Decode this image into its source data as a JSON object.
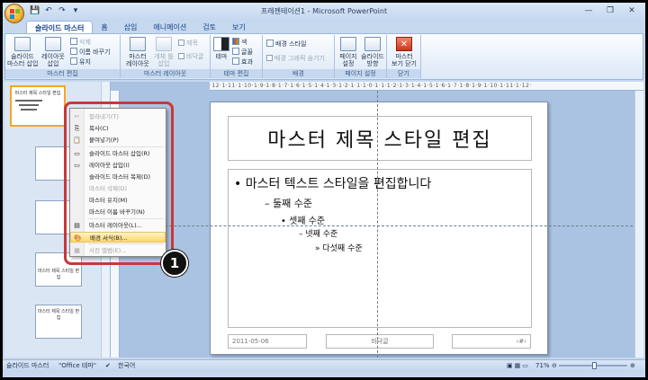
{
  "window": {
    "title": "프레젠테이션1 - Microsoft PowerPoint"
  },
  "qat": {
    "save": "💾",
    "undo": "↶",
    "redo": "↷",
    "more": "▾"
  },
  "window_controls": {
    "minimize": "—",
    "maximize": "❐",
    "close": "✕"
  },
  "tabs": [
    "슬라이드 마스터",
    "홈",
    "삽입",
    "애니메이션",
    "검토",
    "보기"
  ],
  "ribbon": {
    "edit_master": {
      "label": "마스터 편집",
      "insert_slide_master": "슬라이드\n마스터 삽입",
      "insert_layout": "레이아웃\n삽입",
      "delete": "삭제",
      "rename": "이름 바꾸기",
      "preserve": "유지"
    },
    "master_layout": {
      "label": "마스터 레이아웃",
      "master_layout": "마스터\n레이아웃",
      "insert_placeholder": "개체 틀\n삽입",
      "title": "제목",
      "footer": "바닥글"
    },
    "edit_theme": {
      "label": "테마 편집",
      "themes": "테마",
      "colors": "색",
      "fonts": "글꼴",
      "effects": "효과"
    },
    "background": {
      "label": "배경",
      "background_styles": "배경 스타일",
      "hide_bg": "배경 그래픽 숨기기"
    },
    "page_setup": {
      "label": "페이지 설정",
      "page_setup": "페이지\n설정",
      "orientation": "슬라이드\n방향"
    },
    "close": {
      "label": "닫기",
      "close_master": "마스터\n보기 닫기"
    }
  },
  "ruler": {
    "text": "·12·1·11·1·10·1·9·1·8·1·7·1·6·1·5·1·4·1·3·1·2·1·1·1·0·1·1·1·2·1·3·1·4·1·5·1·6·1·7·1·8·1·9·1·10·1·11·1·12·"
  },
  "slide": {
    "title": "마스터 제목 스타일 편집",
    "level1": "• 마스터 텍스트 스타일을 편집합니다",
    "level2": "– 둘째 수준",
    "level3": "• 셋째 수준",
    "level4": "– 넷째 수준",
    "level5": "» 다섯째 수준",
    "footer_date": "2011-05-06",
    "footer_text": "바닥글",
    "footer_num": "‹#›"
  },
  "thumbnails": {
    "master_title": "마스터 제목 스타일 편집"
  },
  "context_menu": {
    "items": [
      {
        "icon": "✂",
        "label": "잘라내기(T)",
        "enabled": false
      },
      {
        "icon": "⎘",
        "label": "복사(C)",
        "enabled": true
      },
      {
        "icon": "📋",
        "label": "붙여넣기(P)",
        "enabled": true
      },
      {
        "icon": "▭",
        "label": "슬라이드 마스터 삽입(R)",
        "enabled": true
      },
      {
        "icon": "▭",
        "label": "레이아웃 삽입(I)",
        "enabled": true
      },
      {
        "icon": "",
        "label": "슬라이드 마스터 복제(D)",
        "enabled": true
      },
      {
        "icon": "",
        "label": "마스터 삭제(D)",
        "enabled": false
      },
      {
        "icon": "",
        "label": "마스터 유지(M)",
        "enabled": true
      },
      {
        "icon": "",
        "label": "마스터 이름 바꾸기(N)",
        "enabled": true
      },
      {
        "icon": "▤",
        "label": "마스터 레이아웃(L)...",
        "enabled": true
      },
      {
        "icon": "🎨",
        "label": "배경 서식(B)...",
        "enabled": true,
        "highlighted": true
      },
      {
        "icon": "▦",
        "label": "사진 앨범(E)...",
        "enabled": false
      }
    ]
  },
  "callout": {
    "number": "1"
  },
  "status": {
    "view": "슬라이드 마스터",
    "theme": "\"Office 테마\"",
    "language": "한국어",
    "zoom": "71%",
    "zoom_out": "⊖",
    "zoom_in": "⊕"
  },
  "colors": {
    "accent": "#15428b",
    "highlight_ring": "#c8383a",
    "menu_hover": "#ffd765"
  }
}
